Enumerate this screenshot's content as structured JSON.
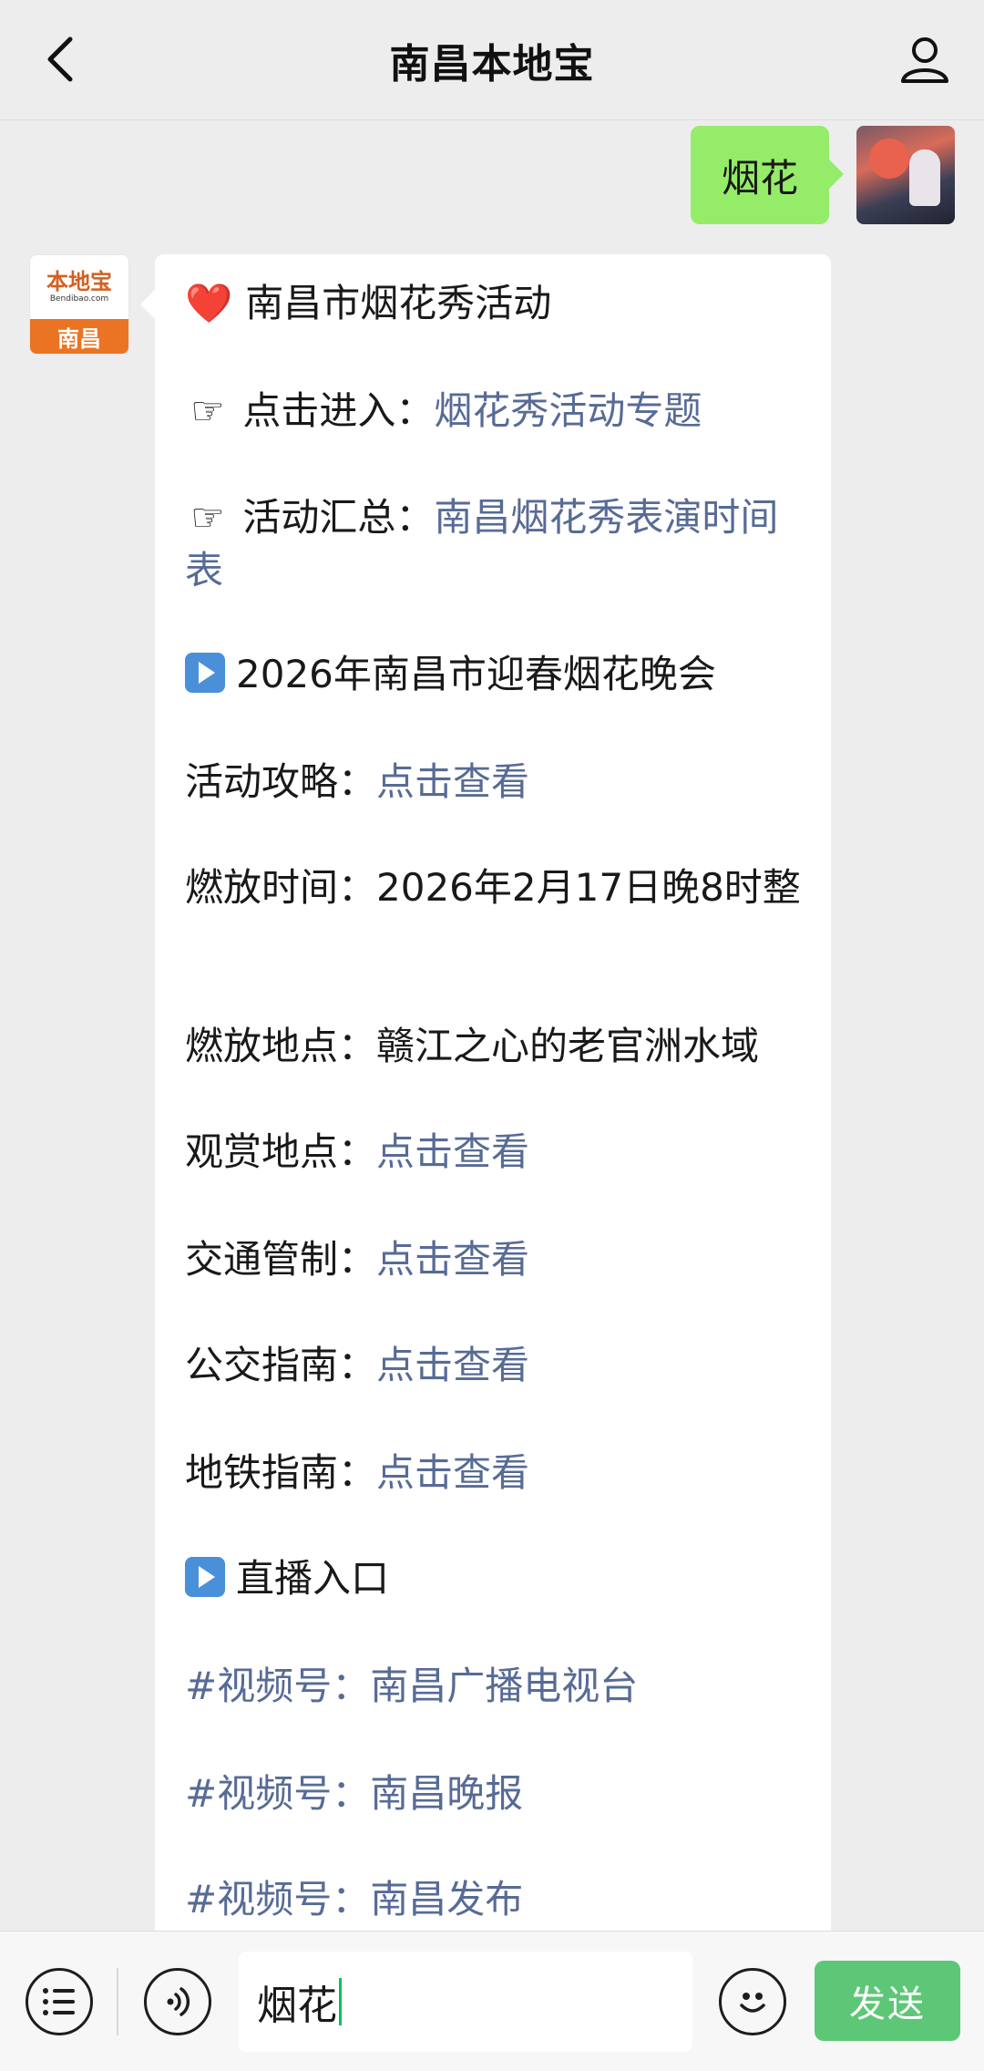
{
  "header": {
    "title": "南昌本地宝",
    "back_icon": "chevron-left-icon",
    "profile_icon": "person-icon"
  },
  "outgoing": {
    "text": "烟花"
  },
  "bot_avatar": {
    "brand": "本地宝",
    "url": "Bendibao.com",
    "city": "南昌"
  },
  "message": {
    "heart": "❤️",
    "headline": "南昌市烟花秀活动",
    "pointer": "☞",
    "entry_label": "点击进入：",
    "entry_link": "烟花秀活动专题",
    "summary_label": "活动汇总：",
    "summary_link": "南昌烟花秀表演时间表",
    "section1_title": "2026年南昌市迎春烟花晚会",
    "guide_label": "活动攻略：",
    "guide_link": "点击查看",
    "time_label": "燃放时间：",
    "time_value": "2026年2月17日晚8时整",
    "place_label": "燃放地点：",
    "place_value": "赣江之心的老官洲水域",
    "view_label": "观赏地点：",
    "view_link": "点击查看",
    "traffic_label": "交通管制：",
    "traffic_link": "点击查看",
    "bus_label": "公交指南：",
    "bus_link": "点击查看",
    "metro_label": "地铁指南：",
    "metro_link": "点击查看",
    "section2_title": "直播入口",
    "channel1": "#视频号：南昌广播电视台",
    "channel2": "#视频号：南昌晚报",
    "channel3": "#视频号：南昌发布"
  },
  "input_bar": {
    "menu_icon": "list-menu-icon",
    "voice_icon": "voice-icon",
    "input_value": "烟花",
    "emoji_icon": "emoji-icon",
    "send_label": "发送"
  },
  "colors": {
    "link": "#576b95",
    "outgoing_bubble": "#95ec69",
    "send_button": "#5dc777"
  }
}
